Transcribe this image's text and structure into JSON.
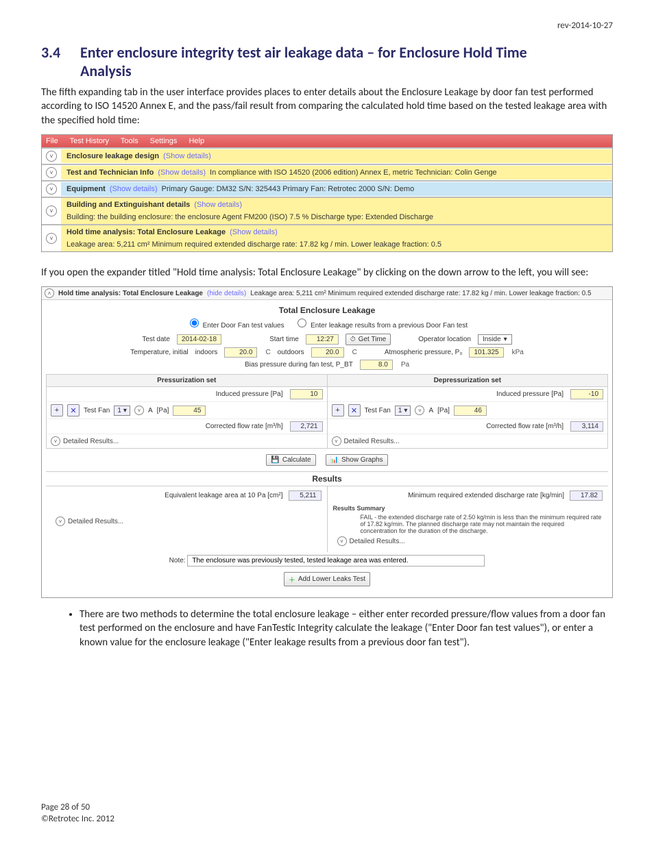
{
  "rev": "rev-2014-10-27",
  "section_num": "3.4",
  "section_title": "Enter enclosure integrity test air leakage data – for Enclosure Hold Time Analysis",
  "intro": "The fifth expanding tab in the user interface provides places to enter details about the Enclosure Leakage by door fan test performed according to ISO 14520 Annex E, and the pass/fail result from comparing the calculated hold time based on the tested leakage area with the specified hold time:",
  "menubar": {
    "items": [
      "File",
      "Test History",
      "Tools",
      "Settings",
      "Help"
    ]
  },
  "expanders": [
    {
      "title": "Enclosure leakage design",
      "show": "(Show details)",
      "info": "",
      "cls": "bar-yellow"
    },
    {
      "title": "Test and Technician Info",
      "show": "(Show details)",
      "info": "In compliance with ISO 14520 (2006 edition) Annex E, metric   Technician: Colin Genge",
      "cls": "bar-yellow"
    },
    {
      "title": "Equipment",
      "show": "(Show details)",
      "info": "Primary Gauge: DM32 S/N: 325443   Primary Fan: Retrotec 2000 S/N: Demo",
      "cls": "bar-blue"
    },
    {
      "title": "Building and Extinguishant details",
      "show": "(Show details)",
      "info": "Building: the building   enclosure: the enclosure   Agent FM200 (ISO)   7.5 %   Discharge type: Extended Discharge",
      "cls": "bar-yellow"
    },
    {
      "title": "Hold time analysis: Total Enclosure Leakage",
      "show": "(Show details)",
      "info": "Leakage area: 5,211 cm²   Minimum required extended discharge rate: 17.82 kg / min.   Lower leakage fraction: 0.5",
      "cls": "bar-yellow"
    }
  ],
  "mid_para": "If you open the expander titled \"Hold time analysis: Total Enclosure Leakage\" by clicking on the down arrow to the left, you will see:",
  "s2": {
    "header_title": "Hold time analysis: Total Enclosure Leakage",
    "header_hide": "(hide details)",
    "header_info": "Leakage area: 5,211 cm²   Minimum required extended discharge rate: 17.82 kg / min.   Lower leakage fraction: 0.5",
    "panel_title": "Total Enclosure Leakage",
    "radio1": "Enter Door Fan test values",
    "radio2": "Enter leakage results from a previous Door Fan test",
    "test_date_lbl": "Test date",
    "test_date": "2014-02-18",
    "start_time_lbl": "Start time",
    "start_time": "12:27",
    "get_time_btn": "Get Time",
    "op_loc_lbl": "Operator location",
    "op_loc_val": "Inside",
    "temp_lbl": "Temperature, initial",
    "indoors_lbl": "indoors",
    "indoors": "20.0",
    "indoors_unit": "C",
    "outdoors_lbl": "outdoors",
    "outdoors": "20.0",
    "outdoors_unit": "C",
    "atm_lbl": "Atmospheric pressure, P₀",
    "atm": "101.325",
    "atm_unit": "kPa",
    "bias_lbl": "Bias pressure during fan test, P_BT",
    "bias": "8.0",
    "bias_unit": "Pa",
    "press_set": "Pressurization set",
    "depress_set": "Depressurization set",
    "ind_press_lbl": "Induced pressure [Pa]",
    "p_ind": "10",
    "d_ind": "-10",
    "fan_lbl": "Test Fan",
    "fan_sel": "1",
    "ring_lbl": "A",
    "fan_pa_lbl": "[Pa]",
    "p_pa": "45",
    "d_pa": "46",
    "flow_lbl": "Corrected flow rate [m³/h]",
    "p_flow": "2,721",
    "d_flow": "3,114",
    "det_res": "Detailed Results...",
    "calc_btn": "Calculate",
    "graph_btn": "Show Graphs",
    "results_hdr": "Results",
    "ela_lbl": "Equivalent leakage area at 10 Pa [cm²]",
    "ela": "5,211",
    "min_rate_lbl": "Minimum required extended discharge rate [kg/min]",
    "min_rate": "17.82",
    "summary_hdr": "Results Summary",
    "summary_txt": "FAIL - the extended discharge rate of 2.50 kg/min is less than the minimum required rate of 17.82 kg/min. The planned discharge rate may not maintain the required concentration for the duration of the discharge.",
    "note_lbl": "Note:",
    "note_val": "The enclosure was previously tested, tested leakage area was entered.",
    "add_lower": "Add Lower Leaks Test"
  },
  "bullet": "There are two methods to determine the total enclosure leakage – either enter recorded pressure/flow values from a door fan test performed on the enclosure and have FanTestic Integrity calculate the leakage (\"Enter Door fan test values\"),  or enter a known value for the enclosure leakage (\"Enter leakage results from a previous door fan test\").",
  "footer_page": "Page 28 of 50",
  "footer_copy": "©Retrotec Inc. 2012"
}
